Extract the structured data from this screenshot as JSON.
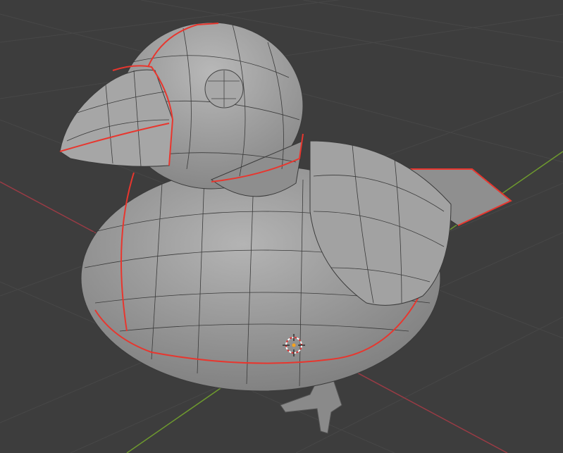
{
  "viewport": {
    "mode": "3d-viewport",
    "background_color": "#3d3d3d",
    "grid_color": "#474747",
    "x_axis_color": "#9a3b45",
    "y_axis_color": "#6e9a2e",
    "mesh_color": "#9c9c9c",
    "wire_color": "#3a3a3a",
    "seam_color": "#e8362e",
    "cursor_icon": "3d-cursor-icon"
  }
}
